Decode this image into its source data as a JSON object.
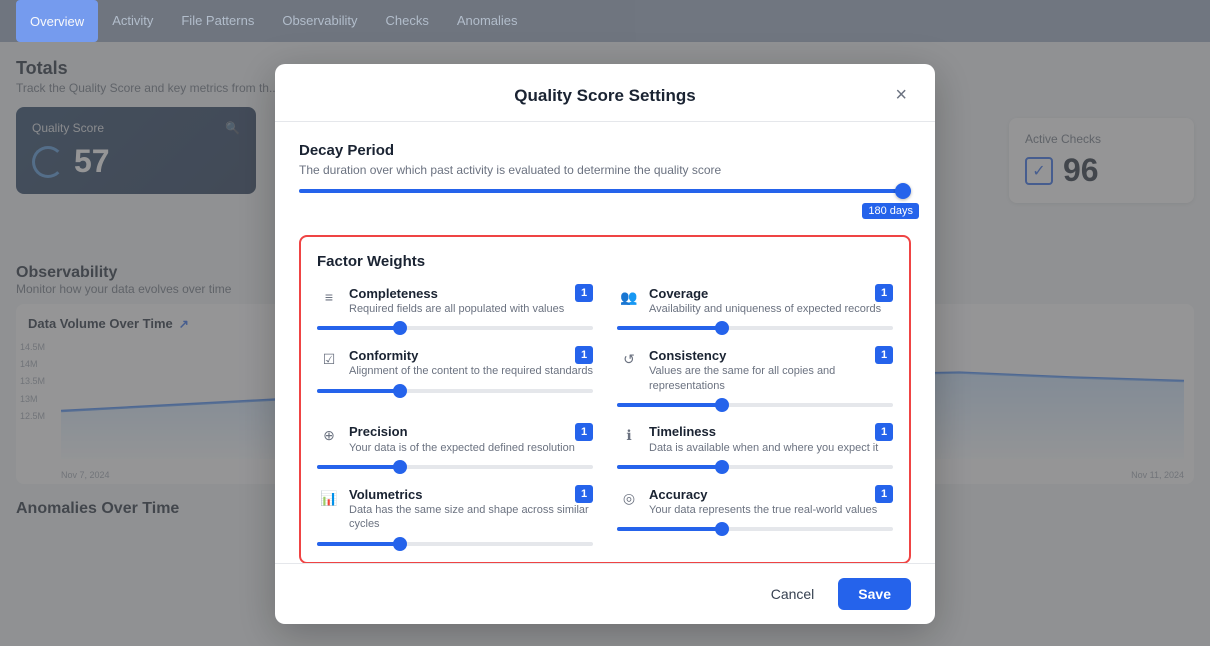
{
  "nav": {
    "tabs": [
      {
        "id": "overview",
        "label": "Overview",
        "active": true
      },
      {
        "id": "activity",
        "label": "Activity",
        "active": false
      },
      {
        "id": "file-patterns",
        "label": "File Patterns",
        "active": false
      },
      {
        "id": "observability",
        "label": "Observability",
        "active": false
      },
      {
        "id": "checks",
        "label": "Checks",
        "active": false
      },
      {
        "id": "anomalies",
        "label": "Anomalies",
        "active": false
      }
    ]
  },
  "page": {
    "totals_title": "Totals",
    "totals_sub": "Track the Quality Score and key metrics from th..."
  },
  "quality_score": {
    "label": "Quality Score",
    "value": "57"
  },
  "active_checks": {
    "label": "Active Checks",
    "value": "96"
  },
  "observability": {
    "title": "Observability",
    "sub": "Monitor how your data evolves over time",
    "chart_title": "Data Volume Over Time",
    "y_labels": [
      "14.5M",
      "14M",
      "13.5M",
      "13M",
      "12.5M"
    ],
    "x_labels": [
      "Nov 7, 2024",
      "Nov 11, 2024"
    ]
  },
  "anomalies": {
    "title": "Anomalies Over Time"
  },
  "modal": {
    "title": "Quality Score Settings",
    "close_label": "×",
    "decay": {
      "title": "Decay Period",
      "description": "The duration over which past activity is evaluated to determine the quality score",
      "value": "180 days",
      "fill_pct": 100
    },
    "factor_weights": {
      "title": "Factor Weights",
      "factors": [
        {
          "id": "completeness",
          "name": "Completeness",
          "desc": "Required fields are all populated with values",
          "badge": "1",
          "fill_pct": 30,
          "icon": "≡"
        },
        {
          "id": "coverage",
          "name": "Coverage",
          "desc": "Availability and uniqueness of expected records",
          "badge": "1",
          "fill_pct": 38,
          "icon": "👥"
        },
        {
          "id": "conformity",
          "name": "Conformity",
          "desc": "Alignment of the content to the required standards",
          "badge": "1",
          "fill_pct": 30,
          "icon": "☑"
        },
        {
          "id": "consistency",
          "name": "Consistency",
          "desc": "Values are the same for all copies and representations",
          "badge": "1",
          "fill_pct": 38,
          "icon": "↺"
        },
        {
          "id": "precision",
          "name": "Precision",
          "desc": "Your data is of the expected defined resolution",
          "badge": "1",
          "fill_pct": 30,
          "icon": "⊕"
        },
        {
          "id": "timeliness",
          "name": "Timeliness",
          "desc": "Data is available when and where you expect it",
          "badge": "1",
          "fill_pct": 38,
          "icon": "ℹ"
        },
        {
          "id": "volumetrics",
          "name": "Volumetrics",
          "desc": "Data has the same size and shape across similar cycles",
          "badge": "1",
          "fill_pct": 30,
          "icon": "📊"
        },
        {
          "id": "accuracy",
          "name": "Accuracy",
          "desc": "Your data represents the true real-world values",
          "badge": "1",
          "fill_pct": 38,
          "icon": "◎"
        }
      ]
    },
    "footer": {
      "cancel_label": "Cancel",
      "save_label": "Save"
    }
  }
}
